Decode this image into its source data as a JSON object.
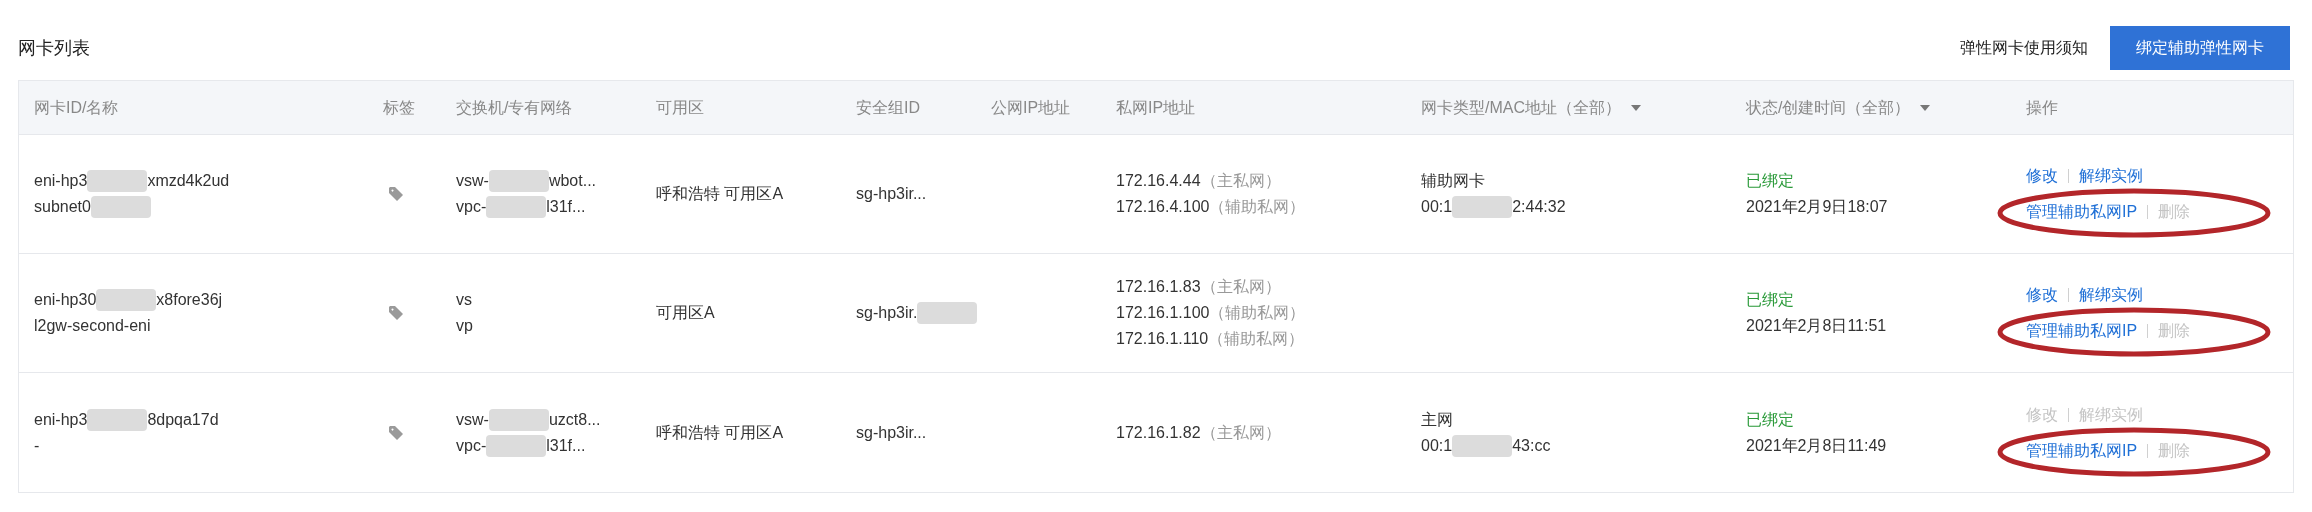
{
  "title": "网卡列表",
  "notice_link": "弹性网卡使用须知",
  "primary_button": "绑定辅助弹性网卡",
  "table": {
    "columns": [
      {
        "label": "网卡ID/名称",
        "filter": false
      },
      {
        "label": "标签",
        "filter": false
      },
      {
        "label": "交换机/专有网络",
        "filter": false
      },
      {
        "label": "可用区",
        "filter": false
      },
      {
        "label": "安全组ID",
        "filter": false
      },
      {
        "label": "公网IP地址",
        "filter": false
      },
      {
        "label": "私网IP地址",
        "filter": false
      },
      {
        "label": "网卡类型/MAC地址（全部）",
        "filter": true
      },
      {
        "label": "状态/创建时间（全部）",
        "filter": true
      },
      {
        "label": "操作",
        "filter": false
      }
    ],
    "rows": [
      {
        "id": [
          [
            {
              "kind": "text",
              "text": "eni-hp3"
            },
            {
              "kind": "blur"
            },
            {
              "kind": "text",
              "text": "xmzd4k2ud"
            }
          ],
          [
            {
              "kind": "text",
              "text": "subnet0"
            },
            {
              "kind": "blur"
            }
          ]
        ],
        "network": [
          [
            {
              "kind": "text",
              "text": "vsw-"
            },
            {
              "kind": "blur"
            },
            {
              "kind": "text",
              "text": "wbot..."
            }
          ],
          [
            {
              "kind": "text",
              "text": "vpc-"
            },
            {
              "kind": "blur"
            },
            {
              "kind": "text",
              "text": "l31f..."
            }
          ]
        ],
        "zone": "呼和浩特 可用区A",
        "security_group": [
          {
            "kind": "text",
            "text": "sg-hp3ir..."
          }
        ],
        "private_ips": [
          {
            "ip": "172.16.4.44",
            "role": "（主私网）"
          },
          {
            "ip": "172.16.4.100",
            "role": "（辅助私网）"
          }
        ],
        "nic_type": "辅助网卡",
        "mac": [
          {
            "kind": "text",
            "text": "00:1"
          },
          {
            "kind": "blur"
          },
          {
            "kind": "text",
            "text": "2:44:32"
          }
        ],
        "status": "已绑定",
        "created": "2021年2月9日18:07",
        "actions": [
          [
            {
              "label": "修改",
              "disabled": false
            },
            {
              "label": "解绑实例",
              "disabled": false
            }
          ],
          [
            {
              "label": "管理辅助私网IP",
              "disabled": false
            },
            {
              "label": "删除",
              "disabled": true
            }
          ]
        ],
        "circled": true
      },
      {
        "id": [
          [
            {
              "kind": "text",
              "text": "eni-hp30"
            },
            {
              "kind": "blur"
            },
            {
              "kind": "text",
              "text": "x8fore36j"
            }
          ],
          [
            {
              "kind": "text",
              "text": "l2gw-second-eni"
            }
          ]
        ],
        "network": [
          [
            {
              "kind": "text",
              "text": "vs"
            }
          ],
          [
            {
              "kind": "text",
              "text": "vp"
            }
          ]
        ],
        "zone": "可用区A",
        "security_group": [
          {
            "kind": "text",
            "text": "sg-hp3ir."
          },
          {
            "kind": "blur"
          }
        ],
        "private_ips": [
          {
            "ip": "172.16.1.83",
            "role": "（主私网）"
          },
          {
            "ip": "172.16.1.100",
            "role": "（辅助私网）"
          },
          {
            "ip": "172.16.1.110",
            "role": "（辅助私网）"
          }
        ],
        "status": "已绑定",
        "created": "2021年2月8日11:51",
        "actions": [
          [
            {
              "label": "修改",
              "disabled": false
            },
            {
              "label": "解绑实例",
              "disabled": false
            }
          ],
          [
            {
              "label": "管理辅助私网IP",
              "disabled": false
            },
            {
              "label": "删除",
              "disabled": true
            }
          ]
        ],
        "circled": true
      },
      {
        "id": [
          [
            {
              "kind": "text",
              "text": "eni-hp3"
            },
            {
              "kind": "blur"
            },
            {
              "kind": "text",
              "text": "8dpqa17d"
            }
          ],
          [
            {
              "kind": "text",
              "text": "-"
            }
          ]
        ],
        "network": [
          [
            {
              "kind": "text",
              "text": "vsw-"
            },
            {
              "kind": "blur"
            },
            {
              "kind": "text",
              "text": "uzct8..."
            }
          ],
          [
            {
              "kind": "text",
              "text": "vpc-"
            },
            {
              "kind": "blur"
            },
            {
              "kind": "text",
              "text": "l31f..."
            }
          ]
        ],
        "zone": "呼和浩特 可用区A",
        "security_group": [
          {
            "kind": "text",
            "text": "sg-hp3ir..."
          }
        ],
        "private_ips": [
          {
            "ip": "172.16.1.82",
            "role": "（主私网）"
          }
        ],
        "nic_type": "主网",
        "mac": [
          {
            "kind": "text",
            "text": "00:1"
          },
          {
            "kind": "blur"
          },
          {
            "kind": "text",
            "text": "43:cc"
          }
        ],
        "status": "已绑定",
        "created": "2021年2月8日11:49",
        "actions": [
          [
            {
              "label": "修改",
              "disabled": true
            },
            {
              "label": "解绑实例",
              "disabled": true
            }
          ],
          [
            {
              "label": "管理辅助私网IP",
              "disabled": false
            },
            {
              "label": "删除",
              "disabled": true
            }
          ]
        ],
        "circled": true
      }
    ]
  }
}
